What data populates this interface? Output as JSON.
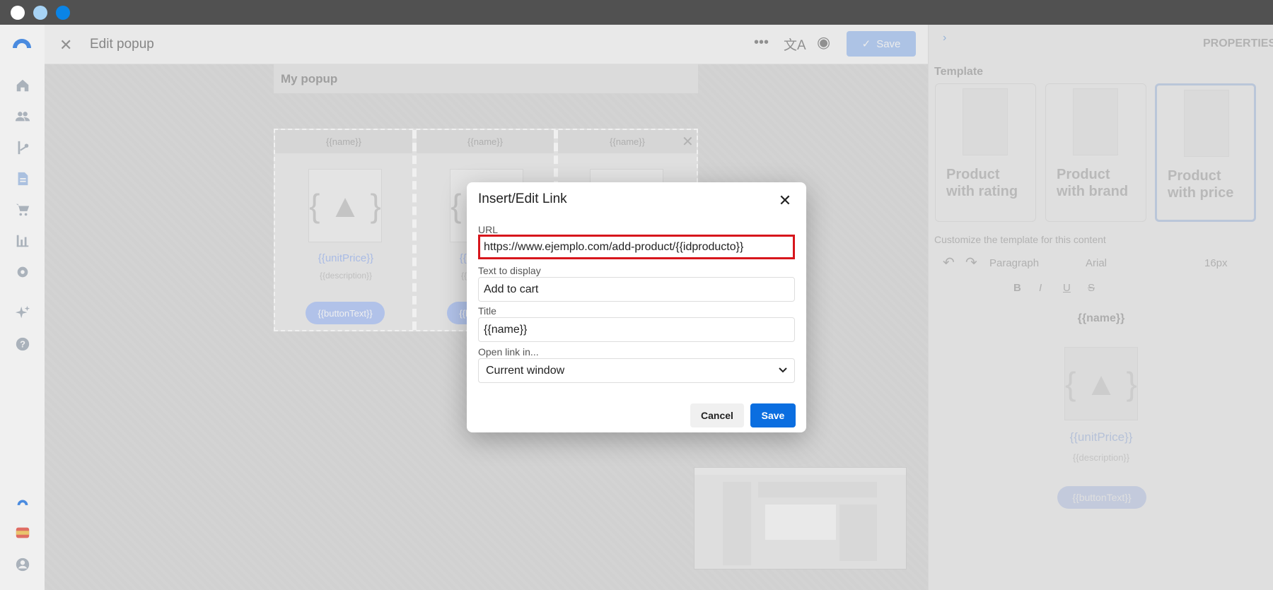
{
  "window": {
    "dot_colors": [
      "#ffffff",
      "#a7d3f5",
      "#0a84e6"
    ]
  },
  "leftnav": {
    "icons": [
      "logo-icon",
      "home-icon",
      "users-icon",
      "flow-icon",
      "document-icon",
      "cart-icon",
      "chart-icon",
      "gear-icon",
      "sparkle-icon",
      "help-icon",
      "brand-logo-icon",
      "flag-spain-icon",
      "user-profile-icon"
    ]
  },
  "topbar": {
    "title": "Edit popup",
    "save_label": "Save"
  },
  "canvas": {
    "popup_title": "My popup",
    "columns": [
      {
        "name": "{{name}}",
        "price": "{{unitPrice}}",
        "description": "{{description}}",
        "button": "{{buttonText}}"
      },
      {
        "name": "{{name}}",
        "price": "{{unitPrice}}",
        "description": "{{description}}",
        "button": "{{buttonText}}"
      },
      {
        "name": "{{name}}"
      }
    ]
  },
  "properties": {
    "heading": "PROPERTIES",
    "template_label": "Template",
    "templates": [
      {
        "label": "Product with rating"
      },
      {
        "label": "Product with brand"
      },
      {
        "label": "Product with price"
      }
    ],
    "customize_label": "Customize the template for this content",
    "paragraph": "Paragraph",
    "font": "Arial",
    "font_size": "16px",
    "preview": {
      "name": "{{name}}",
      "price": "{{unitPrice}}",
      "description": "{{description}}",
      "button": "{{buttonText}}"
    }
  },
  "dialog": {
    "title": "Insert/Edit Link",
    "url_label": "URL",
    "url_value": "https://www.ejemplo.com/add-product/{{idproducto}}",
    "text_label": "Text to display",
    "text_value": "Add to cart",
    "title_label": "Title",
    "title_value": "{{name}}",
    "target_label": "Open link in...",
    "target_value": "Current window",
    "cancel": "Cancel",
    "save": "Save"
  }
}
